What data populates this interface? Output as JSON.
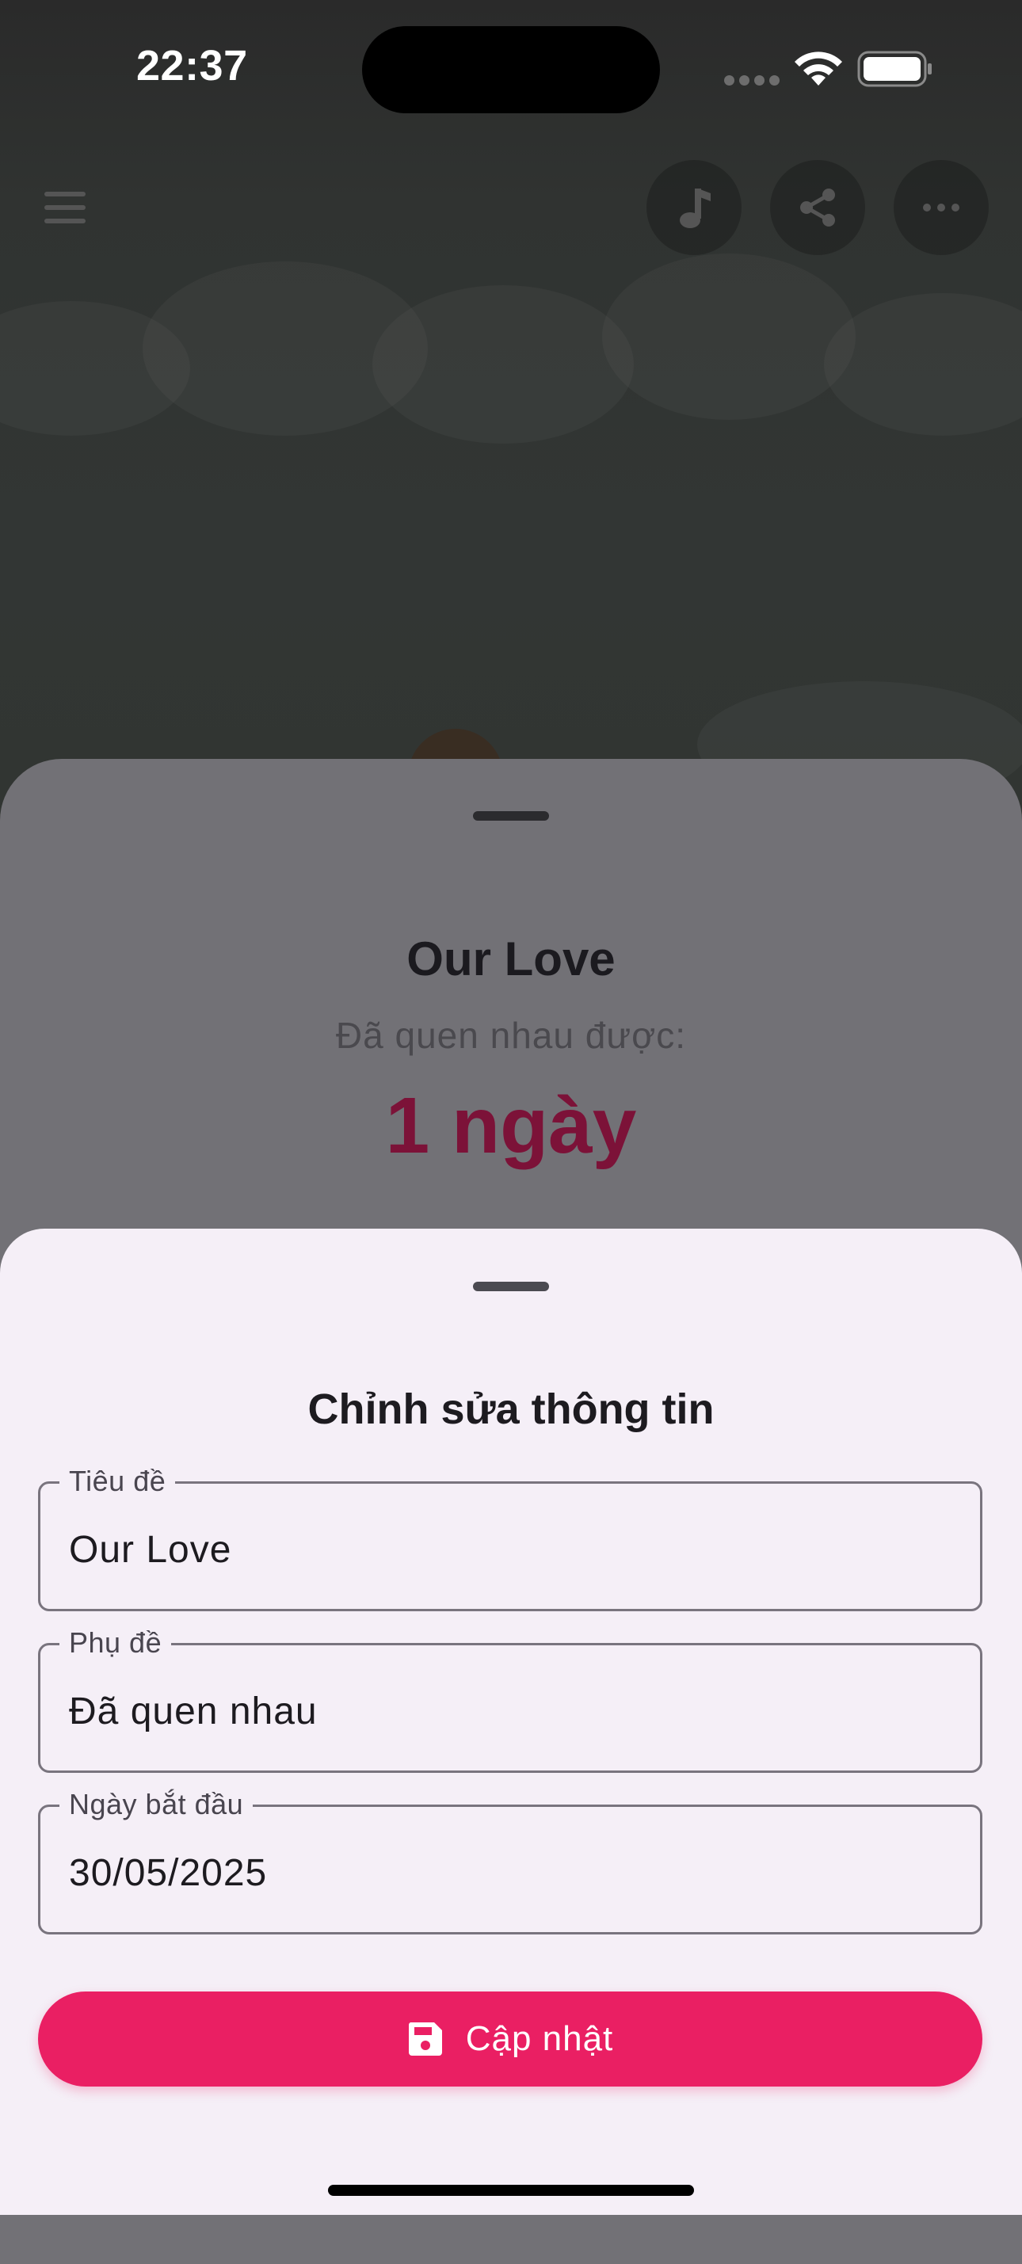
{
  "status_bar": {
    "time": "22:37"
  },
  "background_app": {
    "icons": [
      "menu-icon",
      "music-note-icon",
      "share-icon",
      "more-horizontal-icon"
    ]
  },
  "display_sheet": {
    "title": "Our Love",
    "subtitle": "Đã quen nhau được:",
    "count": "1 ngày"
  },
  "edit_sheet": {
    "heading": "Chỉnh sửa thông tin",
    "fields": [
      {
        "label": "Tiêu đề",
        "value": "Our Love"
      },
      {
        "label": "Phụ đề",
        "value": "Đã quen nhau"
      },
      {
        "label": "Ngày bắt đầu",
        "value": "30/05/2025"
      }
    ],
    "submit": {
      "label": "Cập nhật",
      "icon": "save-icon"
    }
  },
  "colors": {
    "accent": "#ea1f63",
    "sheet_background": "#f5eff7",
    "count_text": "#7c1238"
  }
}
